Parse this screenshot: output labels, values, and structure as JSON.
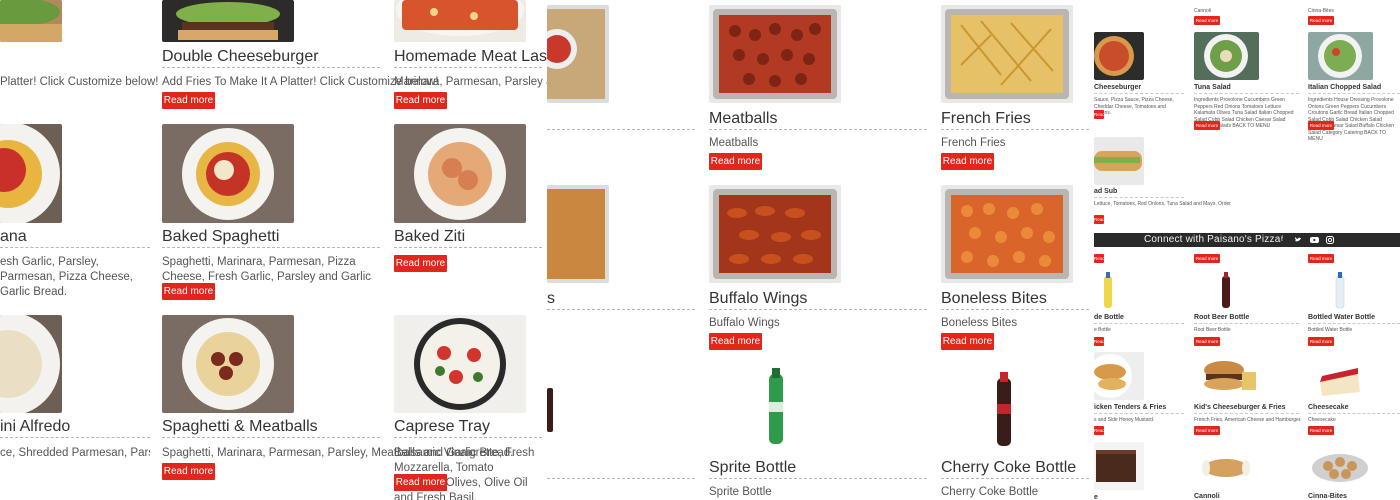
{
  "panel_a": {
    "cards": [
      {
        "title": "Double Cheeseburger",
        "desc": "Add Fries To Make It A Platter! Click Customize below!",
        "button": "Read more"
      },
      {
        "title": "Homemade Meat Lasagna",
        "desc": "Marinara, Parmesan, Parsley and Garlic Bread.",
        "button": "Read more"
      },
      {
        "title": "Baked Spaghetti",
        "desc": "Spaghetti, Marinara, Parmesan, Pizza Cheese, Fresh Garlic, Parsley and Garlic Bread.",
        "button": "Read more"
      },
      {
        "title": "Baked Ziti",
        "desc": "",
        "button": "Read more"
      },
      {
        "title": "Spaghetti & Meatballs",
        "desc": "Spaghetti, Marinara, Parmesan, Parsley, Meatballs and Garlic Bread.",
        "button": "Read more"
      },
      {
        "title": "Caprese Tray",
        "desc": "Balsamic Vinaigrette, Fresh Mozzarella, Tomato Kalamata Olives, Olive Oil and Fresh Basil.",
        "button": "Read more"
      }
    ],
    "partial": [
      {
        "desc": "Platter! Click Customize below!"
      },
      {
        "title": "ana",
        "desc": "esh Garlic, Parsley, Parmesan, Pizza Cheese, Garlic Bread."
      },
      {
        "title": "ini Alfredo",
        "desc": "ce, Shredded Parmesan, Parsley, Grilled Chicken"
      }
    ]
  },
  "panel_b": {
    "cards": [
      {
        "title": "Meatballs",
        "desc": "Meatballs",
        "button": "Read more"
      },
      {
        "title": "French Fries",
        "desc": "French Fries",
        "button": "Read more"
      },
      {
        "title": "Buffalo Wings",
        "desc": "Buffalo Wings",
        "button": "Read more"
      },
      {
        "title": "Boneless Bites",
        "desc": "Boneless Bites",
        "button": "Read more"
      },
      {
        "title": "Sprite Bottle",
        "desc": "Sprite Bottle",
        "button": ""
      },
      {
        "title": "Cherry Coke Bottle",
        "desc": "Cherry Coke Bottle",
        "button": ""
      }
    ],
    "partial_title": "s"
  },
  "panel_c": {
    "top_labels": [
      "Cannoli",
      "Cinna-Bites"
    ],
    "row1": [
      {
        "title": "Cheeseburger",
        "desc": "Sauce, Pizza Sauce, Pizza Cheese, Cheddar Cheese, Tomatoes and Onions."
      },
      {
        "title": "Tuna Salad",
        "desc": "Ingredients Provolone Cucumbers Green Peppers Red Onions Tomatoes Lettuce Kalamata Olives Tuna Salad Italian Chopped Salad Cobb Salad Chicken Caesar Salad Category Salads BACK TO MENU"
      },
      {
        "title": "Italian Chopped Salad",
        "desc": "Ingredients House Dressing Provolone Onions Green Peppers Cucumbers Croutons Garlic Bread Italian Chopped Salad Cobb Salad Chicken Salad Chicken Caesar Salad Buffalo Chicken Salad Category Catering BACK TO MENU"
      }
    ],
    "sub": {
      "title": "ad Sub",
      "desc": "Lettuce, Tomatoes, Red Onions, Tuna Salad and Mayo. Order"
    },
    "connect": "Connect with Paisano's Pizza",
    "row2": [
      {
        "title": "de Bottle",
        "desc": "e Bottle"
      },
      {
        "title": "Root Beer Bottle",
        "desc": "Root Beer Bottle"
      },
      {
        "title": "Bottled Water Bottle",
        "desc": "Bottled Water Bottle"
      }
    ],
    "row3": [
      {
        "title": "icken Tenders & Fries",
        "desc": "s and Side Honey Mustard."
      },
      {
        "title": "Kid's Cheeseburger & Fries",
        "desc": "French Fries, American Cheese and Hamburger."
      },
      {
        "title": "Cheesecake",
        "desc": "Cheesecake"
      }
    ],
    "row4": [
      {
        "title": "e"
      },
      {
        "title": "Cannoli"
      },
      {
        "title": "Cinna-Bites"
      }
    ],
    "button": "Read more"
  },
  "colors": {
    "accent": "#e3261b",
    "divider": "#b5b5b5",
    "bar": "#2a2a2a"
  },
  "social_icons": [
    "facebook-icon",
    "twitter-icon",
    "youtube-icon",
    "instagram-icon"
  ]
}
